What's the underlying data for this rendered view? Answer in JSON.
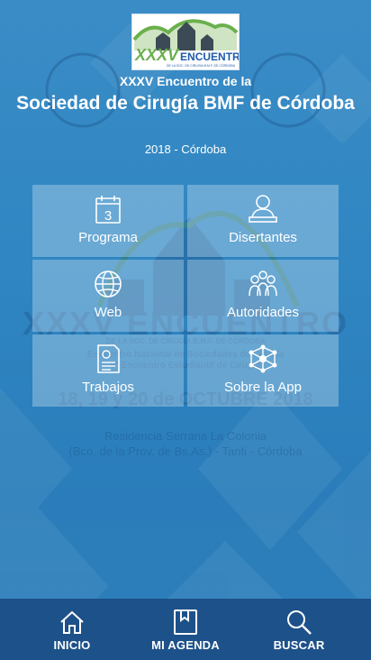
{
  "app": {
    "logo": {
      "line1": "XXXV",
      "line2": "ENCUENTRO",
      "tagline": "DE LA SOC. DE CIRUGÍA B.M.F. DE CÓRDOBA"
    },
    "title_small": "XXXV Encuentro de la",
    "title_big": "Sociedad de Cirugía BMF de Córdoba",
    "subtitle": "2018 - Córdoba"
  },
  "menu": [
    {
      "label": "Programa",
      "icon": "calendar-icon"
    },
    {
      "label": "Disertantes",
      "icon": "speaker-icon"
    },
    {
      "label": "Web",
      "icon": "globe-icon"
    },
    {
      "label": "Autoridades",
      "icon": "people-group-icon"
    },
    {
      "label": "Trabajos",
      "icon": "document-certificate-icon"
    },
    {
      "label": "Sobre la App",
      "icon": "network-icon"
    }
  ],
  "calendar_day": "3",
  "watermark": {
    "heading": "XXXV ENCUENTRO",
    "sub": "DE LA SOC. DE CIRUGÍA B.M.F. DE CÓRDOBA",
    "line1": "Encuentro Nacional de Sociedades de Cirugía",
    "line2": "9º Encuentro Estudiantil de Cirugía",
    "dates": "18, 19 y 20 de OCTUBRE 2018",
    "venue1": "Residencia Serrana La Colonia",
    "venue2": "(Bco. de la Prov. de Bs.As.) - Tanti - Córdoba"
  },
  "nav": [
    {
      "label": "INICIO",
      "icon": "home-icon"
    },
    {
      "label": "MI AGENDA",
      "icon": "bookmark-book-icon"
    },
    {
      "label": "BUSCAR",
      "icon": "search-icon"
    }
  ],
  "colors": {
    "background": "#2f86c2",
    "tile": "#e1f0fa",
    "navbar": "#1d5189",
    "logo_green": "#6ab04c",
    "logo_blue": "#1e5aa8"
  }
}
